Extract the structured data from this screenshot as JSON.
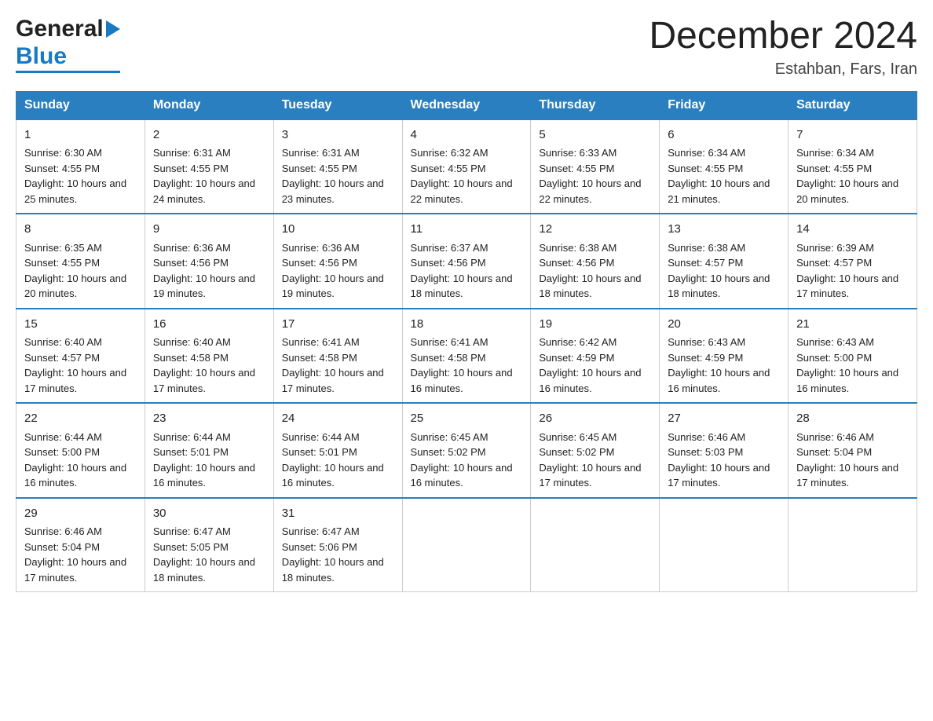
{
  "header": {
    "logo_line1": "General",
    "logo_line2": "Blue",
    "title": "December 2024",
    "subtitle": "Estahban, Fars, Iran"
  },
  "days_of_week": [
    "Sunday",
    "Monday",
    "Tuesday",
    "Wednesday",
    "Thursday",
    "Friday",
    "Saturday"
  ],
  "weeks": [
    [
      {
        "day": "1",
        "sunrise": "6:30 AM",
        "sunset": "4:55 PM",
        "daylight": "10 hours and 25 minutes."
      },
      {
        "day": "2",
        "sunrise": "6:31 AM",
        "sunset": "4:55 PM",
        "daylight": "10 hours and 24 minutes."
      },
      {
        "day": "3",
        "sunrise": "6:31 AM",
        "sunset": "4:55 PM",
        "daylight": "10 hours and 23 minutes."
      },
      {
        "day": "4",
        "sunrise": "6:32 AM",
        "sunset": "4:55 PM",
        "daylight": "10 hours and 22 minutes."
      },
      {
        "day": "5",
        "sunrise": "6:33 AM",
        "sunset": "4:55 PM",
        "daylight": "10 hours and 22 minutes."
      },
      {
        "day": "6",
        "sunrise": "6:34 AM",
        "sunset": "4:55 PM",
        "daylight": "10 hours and 21 minutes."
      },
      {
        "day": "7",
        "sunrise": "6:34 AM",
        "sunset": "4:55 PM",
        "daylight": "10 hours and 20 minutes."
      }
    ],
    [
      {
        "day": "8",
        "sunrise": "6:35 AM",
        "sunset": "4:55 PM",
        "daylight": "10 hours and 20 minutes."
      },
      {
        "day": "9",
        "sunrise": "6:36 AM",
        "sunset": "4:56 PM",
        "daylight": "10 hours and 19 minutes."
      },
      {
        "day": "10",
        "sunrise": "6:36 AM",
        "sunset": "4:56 PM",
        "daylight": "10 hours and 19 minutes."
      },
      {
        "day": "11",
        "sunrise": "6:37 AM",
        "sunset": "4:56 PM",
        "daylight": "10 hours and 18 minutes."
      },
      {
        "day": "12",
        "sunrise": "6:38 AM",
        "sunset": "4:56 PM",
        "daylight": "10 hours and 18 minutes."
      },
      {
        "day": "13",
        "sunrise": "6:38 AM",
        "sunset": "4:57 PM",
        "daylight": "10 hours and 18 minutes."
      },
      {
        "day": "14",
        "sunrise": "6:39 AM",
        "sunset": "4:57 PM",
        "daylight": "10 hours and 17 minutes."
      }
    ],
    [
      {
        "day": "15",
        "sunrise": "6:40 AM",
        "sunset": "4:57 PM",
        "daylight": "10 hours and 17 minutes."
      },
      {
        "day": "16",
        "sunrise": "6:40 AM",
        "sunset": "4:58 PM",
        "daylight": "10 hours and 17 minutes."
      },
      {
        "day": "17",
        "sunrise": "6:41 AM",
        "sunset": "4:58 PM",
        "daylight": "10 hours and 17 minutes."
      },
      {
        "day": "18",
        "sunrise": "6:41 AM",
        "sunset": "4:58 PM",
        "daylight": "10 hours and 16 minutes."
      },
      {
        "day": "19",
        "sunrise": "6:42 AM",
        "sunset": "4:59 PM",
        "daylight": "10 hours and 16 minutes."
      },
      {
        "day": "20",
        "sunrise": "6:43 AM",
        "sunset": "4:59 PM",
        "daylight": "10 hours and 16 minutes."
      },
      {
        "day": "21",
        "sunrise": "6:43 AM",
        "sunset": "5:00 PM",
        "daylight": "10 hours and 16 minutes."
      }
    ],
    [
      {
        "day": "22",
        "sunrise": "6:44 AM",
        "sunset": "5:00 PM",
        "daylight": "10 hours and 16 minutes."
      },
      {
        "day": "23",
        "sunrise": "6:44 AM",
        "sunset": "5:01 PM",
        "daylight": "10 hours and 16 minutes."
      },
      {
        "day": "24",
        "sunrise": "6:44 AM",
        "sunset": "5:01 PM",
        "daylight": "10 hours and 16 minutes."
      },
      {
        "day": "25",
        "sunrise": "6:45 AM",
        "sunset": "5:02 PM",
        "daylight": "10 hours and 16 minutes."
      },
      {
        "day": "26",
        "sunrise": "6:45 AM",
        "sunset": "5:02 PM",
        "daylight": "10 hours and 17 minutes."
      },
      {
        "day": "27",
        "sunrise": "6:46 AM",
        "sunset": "5:03 PM",
        "daylight": "10 hours and 17 minutes."
      },
      {
        "day": "28",
        "sunrise": "6:46 AM",
        "sunset": "5:04 PM",
        "daylight": "10 hours and 17 minutes."
      }
    ],
    [
      {
        "day": "29",
        "sunrise": "6:46 AM",
        "sunset": "5:04 PM",
        "daylight": "10 hours and 17 minutes."
      },
      {
        "day": "30",
        "sunrise": "6:47 AM",
        "sunset": "5:05 PM",
        "daylight": "10 hours and 18 minutes."
      },
      {
        "day": "31",
        "sunrise": "6:47 AM",
        "sunset": "5:06 PM",
        "daylight": "10 hours and 18 minutes."
      },
      null,
      null,
      null,
      null
    ]
  ],
  "labels": {
    "sunrise": "Sunrise:",
    "sunset": "Sunset:",
    "daylight": "Daylight:"
  }
}
